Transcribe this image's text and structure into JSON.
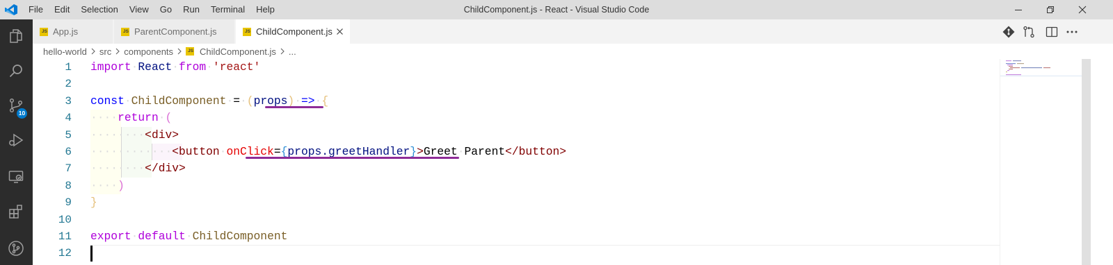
{
  "menubar": {
    "items": [
      "File",
      "Edit",
      "Selection",
      "View",
      "Go",
      "Run",
      "Terminal",
      "Help"
    ]
  },
  "window": {
    "title": "ChildComponent.js - React - Visual Studio Code"
  },
  "activitybar": {
    "icons": [
      "explorer-icon",
      "search-icon",
      "source-control-icon",
      "run-debug-icon",
      "remote-explorer-icon",
      "extensions-icon",
      "git-graph-icon"
    ],
    "scm_badge": "10"
  },
  "tabs": [
    {
      "label": "App.js",
      "icon_text": "JS",
      "active": false
    },
    {
      "label": "ParentComponent.js",
      "icon_text": "JS",
      "active": false
    },
    {
      "label": "ChildComponent.js",
      "icon_text": "JS",
      "active": true
    }
  ],
  "breadcrumb": {
    "items": [
      "hello-world",
      "src",
      "components",
      "ChildComponent.js",
      "..."
    ],
    "file_icon_text": "JS"
  },
  "editor": {
    "line_numbers": [
      "1",
      "2",
      "3",
      "4",
      "5",
      "6",
      "7",
      "8",
      "9",
      "10",
      "11",
      "12"
    ],
    "lines": [
      "import React from 'react'",
      "",
      "const ChildComponent = (props) => {",
      "    return (",
      "        <div>",
      "            <button onClick={props.greetHandler}>Greet Parent</button>",
      "        </div>",
      "    )",
      "}",
      "",
      "export default ChildComponent",
      ""
    ]
  },
  "colors": {
    "titlebar": "#dddddd",
    "activitybar": "#2c2c2c",
    "accent": "#007acc",
    "underline": "#8e2c97",
    "keyword": "#af00db",
    "line_number": "#237893"
  }
}
